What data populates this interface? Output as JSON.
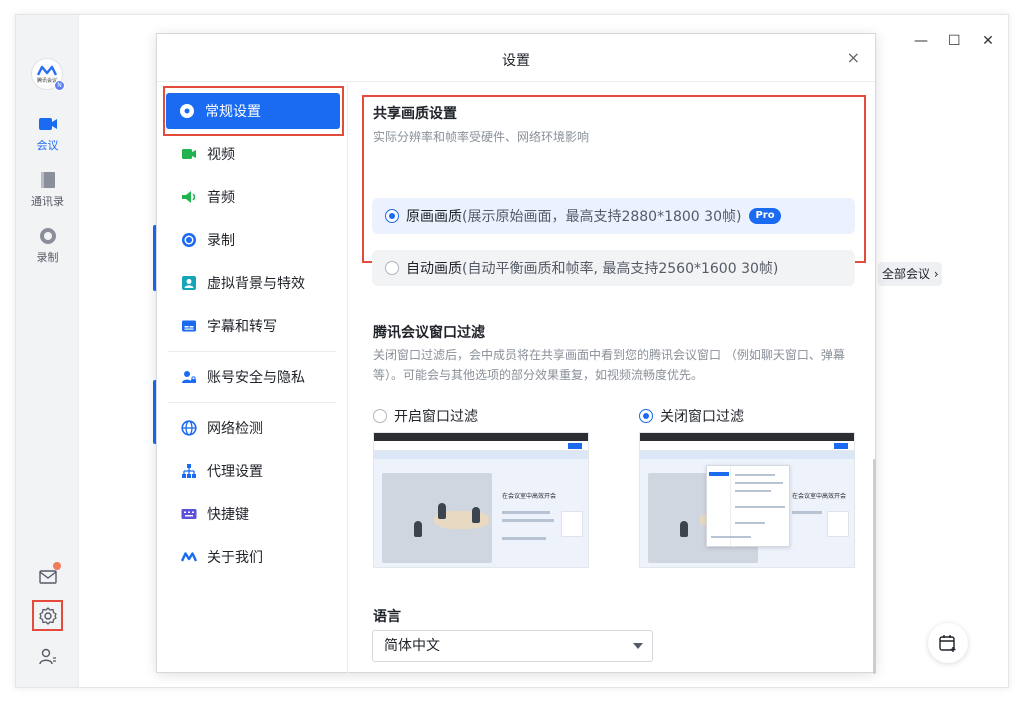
{
  "app": {
    "logo_text": "腾讯会议",
    "logo_badge": "N",
    "rail": [
      {
        "label": "会议",
        "icon": "video-camera-icon",
        "active": true
      },
      {
        "label": "通讯录",
        "icon": "contacts-book-icon",
        "active": false
      },
      {
        "label": "录制",
        "icon": "record-icon",
        "active": false
      }
    ],
    "all_meetings_label": "全部会议 ›",
    "window_controls": {
      "minimize": "—",
      "maximize": "☐",
      "close": "✕"
    }
  },
  "dialog": {
    "title": "设置",
    "close": "×",
    "nav": [
      {
        "label": "常规设置",
        "icon": "gear-icon",
        "active": true
      },
      {
        "label": "视频",
        "icon": "video-camera-icon"
      },
      {
        "label": "音频",
        "icon": "speaker-icon"
      },
      {
        "label": "录制",
        "icon": "record-icon"
      },
      {
        "label": "虚拟背景与特效",
        "icon": "portrait-icon"
      },
      {
        "label": "字幕和转写",
        "icon": "subtitles-icon"
      },
      {
        "label": "账号安全与隐私",
        "icon": "user-lock-icon"
      },
      {
        "label": "网络检测",
        "icon": "globe-icon"
      },
      {
        "label": "代理设置",
        "icon": "network-tree-icon"
      },
      {
        "label": "快捷键",
        "icon": "keyboard-icon"
      },
      {
        "label": "关于我们",
        "icon": "tencent-meeting-logo-icon"
      }
    ]
  },
  "share_quality": {
    "title": "共享画质设置",
    "desc": "实际分辨率和帧率受硬件、网络环境影响",
    "options": [
      {
        "label": "原画画质",
        "sub": "(展示原始画面，最高支持2880*1800 30帧)",
        "badge": "Pro",
        "selected": true
      },
      {
        "label": "自动画质",
        "sub": "(自动平衡画质和帧率, 最高支持2560*1600 30帧)",
        "selected": false
      }
    ]
  },
  "window_filter": {
    "title": "腾讯会议窗口过滤",
    "desc_line1": "关闭窗口过滤后，会中成员将在共享画面中看到您的腾讯会议窗口 （例如聊天窗口、弹幕",
    "desc_line2": "等）。可能会与其他选项的部分效果重复，如视频流畅度优先。",
    "options": [
      {
        "label": "开启窗口过滤",
        "selected": false
      },
      {
        "label": "关闭窗口过滤",
        "selected": true
      }
    ],
    "preview_heading": "在会议室中高效开会"
  },
  "language": {
    "label": "语言",
    "value": "简体中文"
  },
  "colors": {
    "accent": "#1a6bf2",
    "highlight_border": "#e34c3d"
  }
}
